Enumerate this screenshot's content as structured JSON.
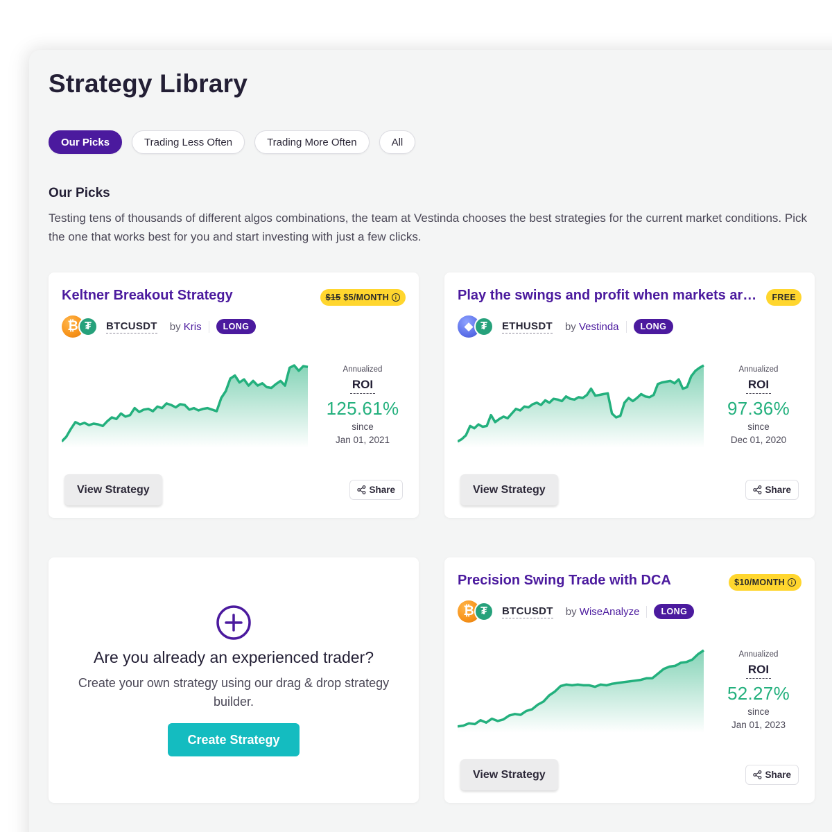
{
  "page": {
    "title": "Strategy Library"
  },
  "tabs": [
    {
      "label": "Our Picks",
      "active": true
    },
    {
      "label": "Trading Less Often",
      "active": false
    },
    {
      "label": "Trading More Often",
      "active": false
    },
    {
      "label": "All",
      "active": false
    }
  ],
  "section": {
    "title": "Our Picks",
    "description": "Testing tens of thousands of different algos combinations, the team at Vestinda chooses the best strategies for the current market conditions. Pick the one that works best for you and start investing with just a few clicks."
  },
  "colors": {
    "accent": "#4b1a9e",
    "roi_green": "#23b07d",
    "price_badge": "#ffd62e",
    "create_button": "#14bcc0"
  },
  "strategies": [
    {
      "name": "Keltner Breakout Strategy",
      "price_old": "$15",
      "price": "$5/MONTH",
      "price_icon": "info-icon",
      "base_coin_icon": "bitcoin-icon",
      "quote_coin_icon": "tether-icon",
      "pair": "BTCUSDT",
      "by_prefix": "by",
      "author": "Kris",
      "direction": "LONG",
      "roi_caption": "Annualized",
      "roi_label": "ROI",
      "roi": "125.61%",
      "since_label": "since",
      "since": "Jan 01, 2021",
      "view_label": "View Strategy",
      "share_label": "Share",
      "sparkline": [
        0.02,
        0.08,
        0.18,
        0.27,
        0.24,
        0.26,
        0.23,
        0.25,
        0.24,
        0.22,
        0.28,
        0.33,
        0.31,
        0.38,
        0.34,
        0.36,
        0.45,
        0.4,
        0.43,
        0.44,
        0.41,
        0.47,
        0.45,
        0.51,
        0.49,
        0.46,
        0.5,
        0.49,
        0.43,
        0.45,
        0.42,
        0.44,
        0.45,
        0.43,
        0.41,
        0.58,
        0.67,
        0.83,
        0.87,
        0.78,
        0.82,
        0.74,
        0.8,
        0.74,
        0.77,
        0.72,
        0.71,
        0.76,
        0.8,
        0.74,
        0.97,
        1.0,
        0.93,
        0.99,
        0.98
      ]
    },
    {
      "name": "Play the swings and profit when markets are ranging",
      "price": "FREE",
      "base_coin_icon": "ethereum-icon",
      "quote_coin_icon": "tether-icon",
      "pair": "ETHUSDT",
      "by_prefix": "by",
      "author": "Vestinda",
      "direction": "LONG",
      "roi_caption": "Annualized",
      "roi_label": "ROI",
      "roi": "97.36%",
      "since_label": "since",
      "since": "Dec 01, 2020",
      "view_label": "View Strategy",
      "share_label": "Share",
      "sparkline": [
        0.02,
        0.05,
        0.1,
        0.22,
        0.19,
        0.24,
        0.21,
        0.22,
        0.36,
        0.27,
        0.31,
        0.34,
        0.32,
        0.38,
        0.44,
        0.42,
        0.47,
        0.46,
        0.5,
        0.52,
        0.49,
        0.55,
        0.52,
        0.57,
        0.56,
        0.54,
        0.6,
        0.57,
        0.56,
        0.59,
        0.58,
        0.62,
        0.7,
        0.61,
        0.62,
        0.63,
        0.64,
        0.38,
        0.33,
        0.35,
        0.52,
        0.58,
        0.54,
        0.58,
        0.63,
        0.6,
        0.59,
        0.62,
        0.76,
        0.78,
        0.79,
        0.8,
        0.77,
        0.82,
        0.7,
        0.72,
        0.86,
        0.93,
        0.97,
        1.0
      ]
    },
    {
      "name": "Precision Swing Trade with DCA",
      "price": "$10/MONTH",
      "price_icon": "info-icon",
      "base_coin_icon": "bitcoin-icon",
      "quote_coin_icon": "tether-icon",
      "pair": "BTCUSDT",
      "by_prefix": "by",
      "author": "WiseAnalyze",
      "direction": "LONG",
      "roi_caption": "Annualized",
      "roi_label": "ROI",
      "roi": "52.27%",
      "since_label": "since",
      "since": "Jan 01, 2023",
      "view_label": "View Strategy",
      "share_label": "Share",
      "sparkline": [
        0.02,
        0.03,
        0.06,
        0.05,
        0.1,
        0.07,
        0.12,
        0.09,
        0.11,
        0.16,
        0.18,
        0.17,
        0.22,
        0.24,
        0.3,
        0.34,
        0.42,
        0.47,
        0.54,
        0.56,
        0.55,
        0.56,
        0.55,
        0.55,
        0.53,
        0.56,
        0.55,
        0.57,
        0.58,
        0.59,
        0.6,
        0.61,
        0.62,
        0.64,
        0.64,
        0.7,
        0.76,
        0.79,
        0.8,
        0.84,
        0.85,
        0.88,
        0.95,
        1.0
      ]
    }
  ],
  "create": {
    "icon": "plus-circle-icon",
    "title": "Are you already an experienced trader?",
    "description": "Create your own strategy using our drag & drop strategy builder.",
    "button": "Create Strategy"
  }
}
